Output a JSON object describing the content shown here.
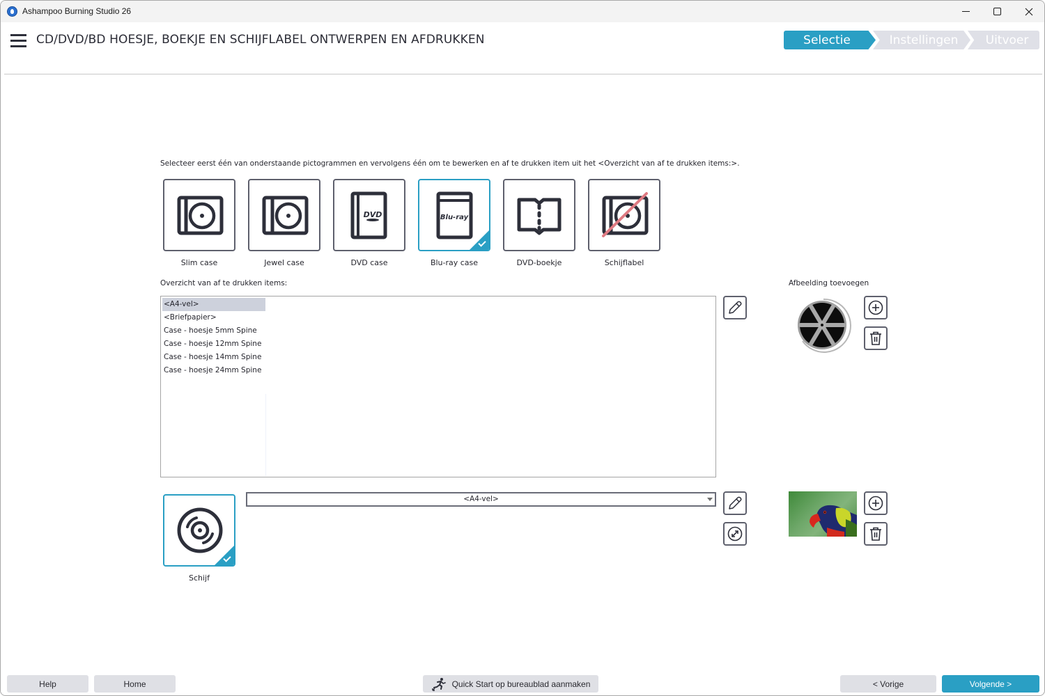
{
  "window": {
    "title": "Ashampoo Burning Studio 26",
    "minimize": "minimize",
    "maximize": "maximize",
    "close": "close"
  },
  "header": {
    "title": "CD/DVD/BD HOESJE, BOEKJE EN SCHIJFLABEL ONTWERPEN EN AFDRUKKEN",
    "steps": [
      {
        "label": "Selectie",
        "active": true
      },
      {
        "label": "Instellingen",
        "active": false
      },
      {
        "label": "Uitvoer",
        "active": false
      }
    ]
  },
  "instruction": "Selecteer eerst één van onderstaande pictogrammen en vervolgens één om te bewerken en af te drukken item uit het <Overzicht van af te drukken items:>.",
  "tiles": [
    {
      "label": "Slim case",
      "icon": "slim-case-icon",
      "selected": false
    },
    {
      "label": "Jewel case",
      "icon": "jewel-case-icon",
      "selected": false
    },
    {
      "label": "DVD case",
      "icon": "dvd-case-icon",
      "selected": false
    },
    {
      "label": "Blu-ray case",
      "icon": "bluray-case-icon",
      "selected": true
    },
    {
      "label": "DVD-boekje",
      "icon": "booklet-icon",
      "selected": false
    },
    {
      "label": "Schijflabel",
      "icon": "disc-label-disabled-icon",
      "selected": false
    }
  ],
  "overview": {
    "label": "Overzicht van af te drukken items:",
    "items": [
      "<A4-vel>",
      "<Briefpapier>",
      "Case - hoesje 5mm Spine",
      "Case - hoesje 12mm Spine",
      "Case - hoesje 14mm Spine",
      "Case - hoesje 24mm Spine"
    ],
    "selected_index": 0
  },
  "image_panel": {
    "label": "Afbeelding toevoegen",
    "image": "film-reel-image"
  },
  "disc": {
    "tile_label": "Schijf",
    "selected": true,
    "dropdown_value": "<A4-vel>",
    "image": "parrot-image"
  },
  "footer": {
    "help": "Help",
    "home": "Home",
    "quick_start": "Quick Start op bureaublad aanmaken",
    "previous": "< Vorige",
    "next": "Volgende >"
  },
  "colors": {
    "accent": "#2a9fc4",
    "inactive_step": "#dfe0e7",
    "button_gray": "#dfe0e5",
    "icon_dark": "#2d2f3a",
    "disabled_slash": "#e07a82"
  }
}
